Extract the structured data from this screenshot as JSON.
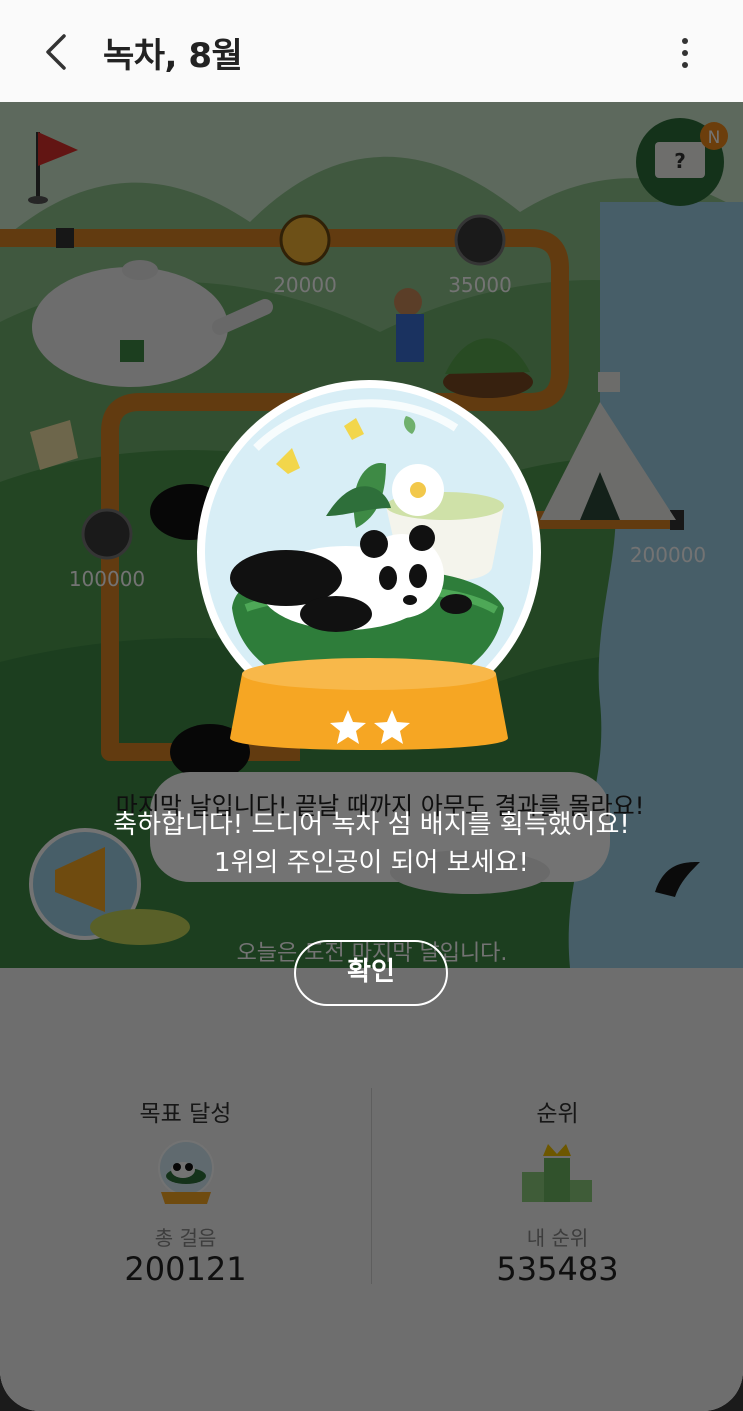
{
  "appbar": {
    "title": "녹차, 8월"
  },
  "map": {
    "milestones": [
      "20000",
      "35000",
      "100000",
      "200000"
    ],
    "balloon_text": "마지막 날입니다! 끝날 때까지 아무도 결과를 몰라요!",
    "footer_text": "오늘은 도전 마지막 날입니다.",
    "notification_badge": "N",
    "mystery_mark": "?"
  },
  "popup": {
    "line1": "축하합니다! 드디어 녹차 섬 배지를 획득했어요!",
    "line2": "1위의 주인공이 되어 보세요!",
    "confirm_label": "확인",
    "stars": 2
  },
  "stats": {
    "goal": {
      "label": "목표 달성",
      "sub": "총 걸음",
      "value": "200121"
    },
    "rank": {
      "label": "순위",
      "sub": "내 순위",
      "value": "535483"
    }
  },
  "colors": {
    "overlay": "#000000",
    "accent_orange": "#f6a623",
    "path_orange": "#d98324",
    "grass_green": "#2e6f3a"
  }
}
